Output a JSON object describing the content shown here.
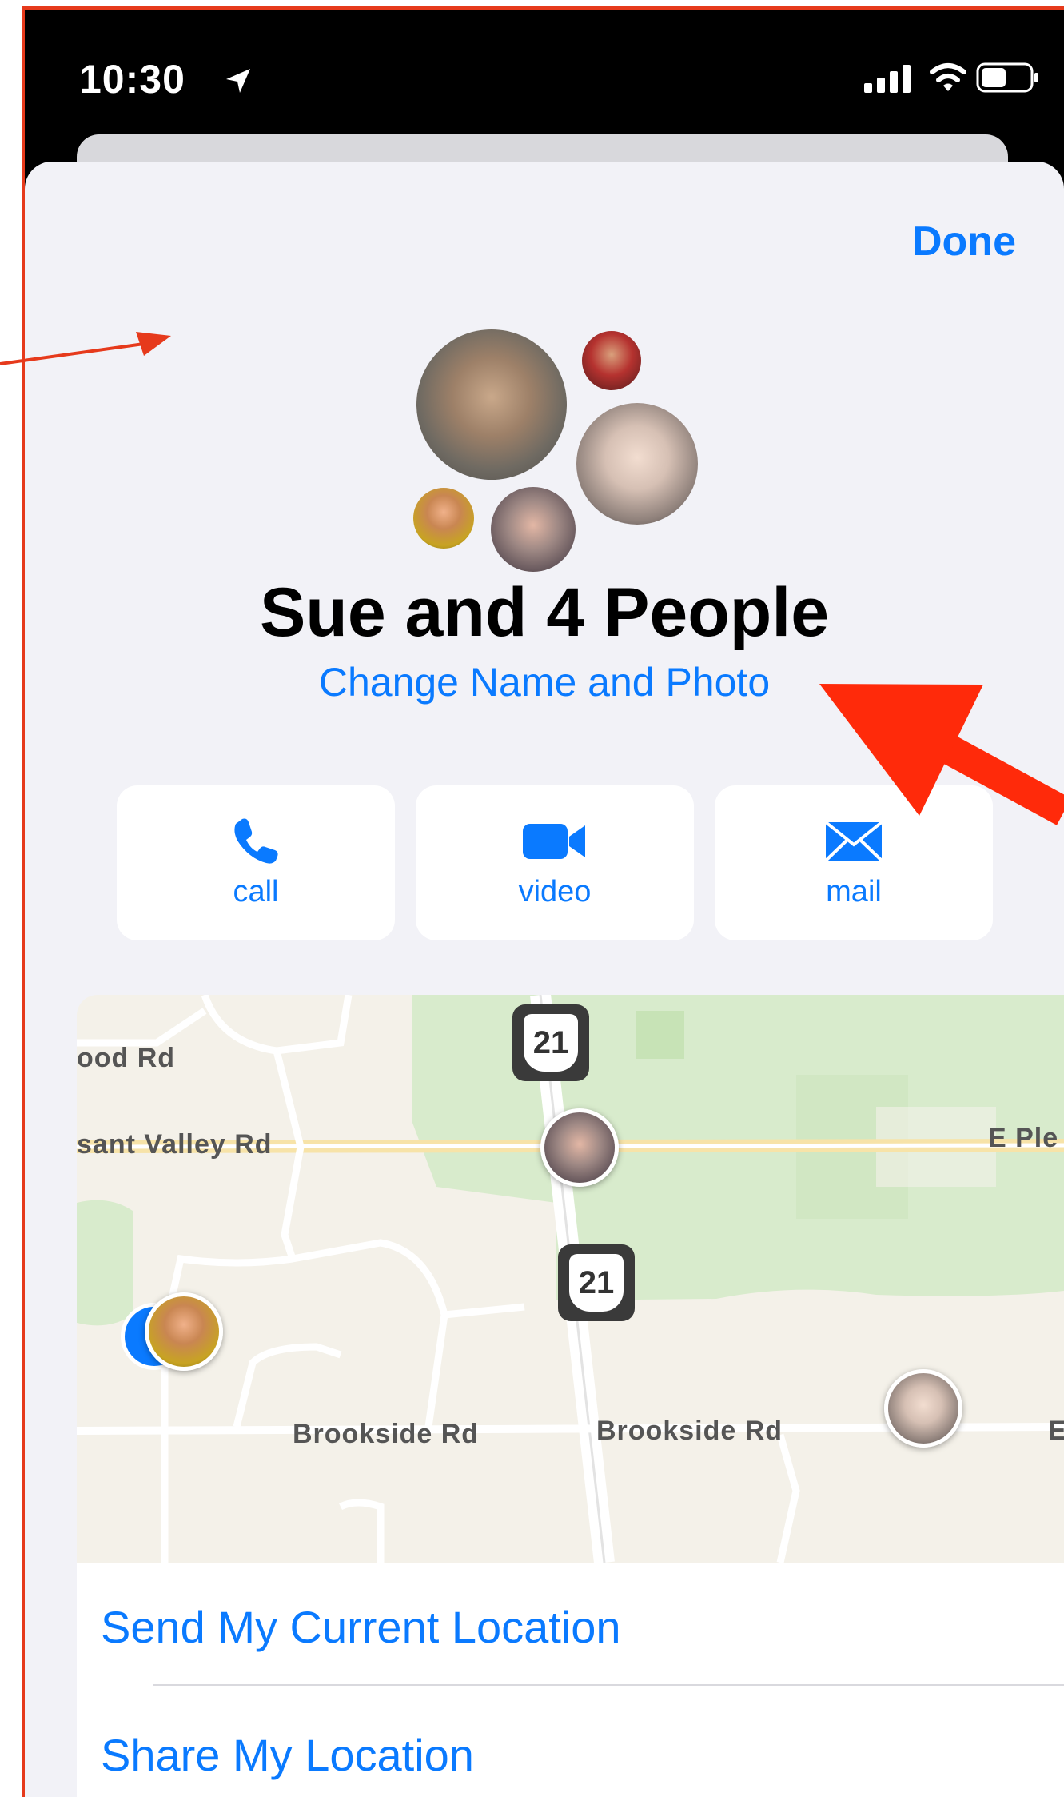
{
  "status_bar": {
    "time": "10:30",
    "location_icon": "location-arrow-icon",
    "signal_icon": "cellular-signal-icon",
    "wifi_icon": "wifi-icon",
    "battery_icon": "battery-icon"
  },
  "header": {
    "done_label": "Done"
  },
  "group": {
    "title": "Sue and 4 People",
    "change_link": "Change Name and Photo"
  },
  "actions": [
    {
      "label": "call",
      "icon": "phone-icon"
    },
    {
      "label": "video",
      "icon": "video-camera-icon"
    },
    {
      "label": "mail",
      "icon": "envelope-icon"
    }
  ],
  "map": {
    "roads": {
      "top_left": "ood Rd",
      "middle": "sant Valley Rd",
      "right": "E Ple",
      "bottom_left": "Brookside Rd",
      "bottom_right": "Brookside Rd",
      "bottom_edge": "E"
    },
    "route_shield": "21"
  },
  "location_options": {
    "send_current": "Send My Current Location",
    "share": "Share My Location"
  },
  "colors": {
    "accent": "#0a7aff",
    "annotation": "#ff2a0a"
  }
}
